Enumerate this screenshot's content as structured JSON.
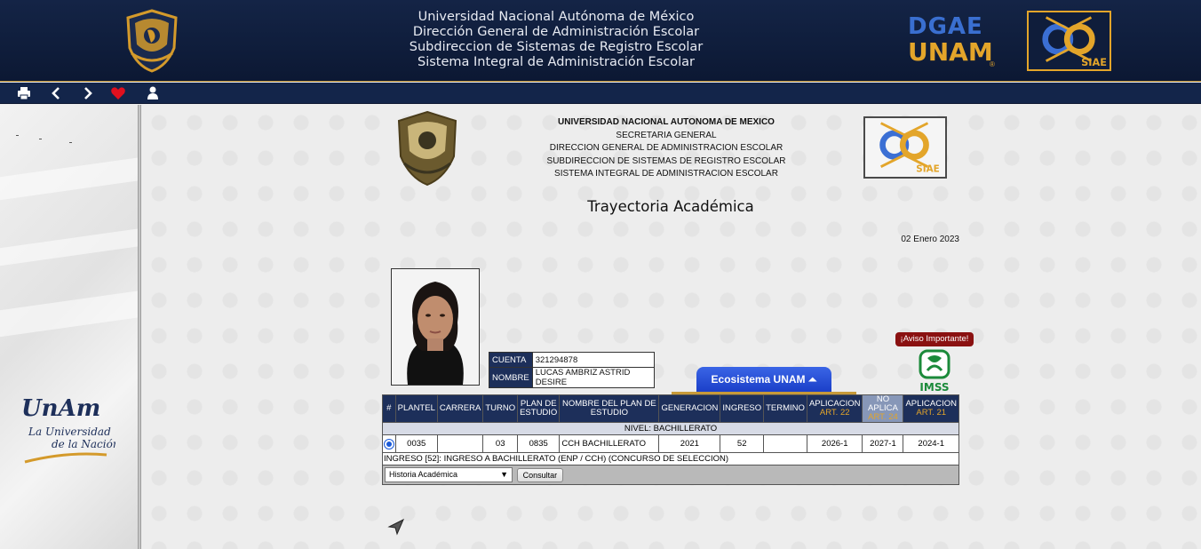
{
  "banner": {
    "lines": [
      "Universidad Nacional Autónoma de México",
      "Dirección General de Administración Escolar",
      "Subdireccion de Sistemas de Registro Escolar",
      "Sistema Integral de Administración Escolar"
    ],
    "dgae_line1": "DGAE",
    "dgae_line2": "UNAM",
    "dgae_reg": "®",
    "siae_label": "SIAE"
  },
  "toolbar": {
    "icons": [
      "print-icon",
      "back-icon",
      "forward-icon",
      "favorite-icon",
      "user-icon"
    ]
  },
  "leftpanel": {
    "logo_line1": "UnAm",
    "logo_line2": "La Universidad",
    "logo_line3": "de la Nación"
  },
  "header": {
    "inst_line1": "UNIVERSIDAD NACIONAL AUTONOMA DE MEXICO",
    "inst_line2": "SECRETARIA GENERAL",
    "inst_line3": "DIRECCION GENERAL DE ADMINISTRACION ESCOLAR",
    "inst_line4": "SUBDIRECCION DE SISTEMAS DE REGISTRO ESCOLAR",
    "inst_line5": "SISTEMA INTEGRAL DE ADMINISTRACION ESCOLAR",
    "title": "Trayectoria Académica",
    "date": "02 Enero 2023",
    "siae_label": "SIAE"
  },
  "student": {
    "cuenta_label": "CUENTA",
    "cuenta_value": "321294878",
    "nombre_label": "NOMBRE",
    "nombre_value": "LUCAS AMBRIZ ASTRID DESIRE"
  },
  "aviso": "¡Aviso Importante!",
  "imss_label": "IMSS",
  "ecosistema": "Ecosistema UNAM ⏶",
  "table": {
    "headers": {
      "num": "#",
      "plantel": "PLANTEL",
      "carrera": "CARRERA",
      "turno": "TURNO",
      "plan1": "PLAN DE",
      "plan2": "ESTUDIO",
      "nombre_plan": "NOMBRE DEL PLAN DE ESTUDIO",
      "generacion": "GENERACION",
      "ingreso": "INGRESO",
      "termino": "TERMINO",
      "ap1_top": "APLICACION",
      "ap1_bot": "ART. 22",
      "noap_top": "NO APLICA",
      "noap_bot": "ART. 24",
      "ap2_top": "APLICACION",
      "ap2_bot": "ART. 21"
    },
    "nivel": "NIVEL: BACHILLERATO",
    "row": {
      "plantel": "0035",
      "carrera": "",
      "turno": "03",
      "plan": "0835",
      "nombre_plan": "CCH BACHILLERATO",
      "generacion": "2021",
      "ingreso": "52",
      "termino": "",
      "art22": "2026-1",
      "art24": "2027-1",
      "art21": "2024-1"
    },
    "ingreso_note": "INGRESO [52]: INGRESO A BACHILLERATO (ENP / CCH) (CONCURSO DE SELECCION)",
    "select_value": "Historia Académica",
    "consultar": "Consultar"
  },
  "colors": {
    "banner_bg": "#142446",
    "header_cell": "#1d2f5a",
    "gold": "#e3a52a",
    "eco_blue": "#1b3fc8",
    "aviso_red": "#8a1111"
  }
}
